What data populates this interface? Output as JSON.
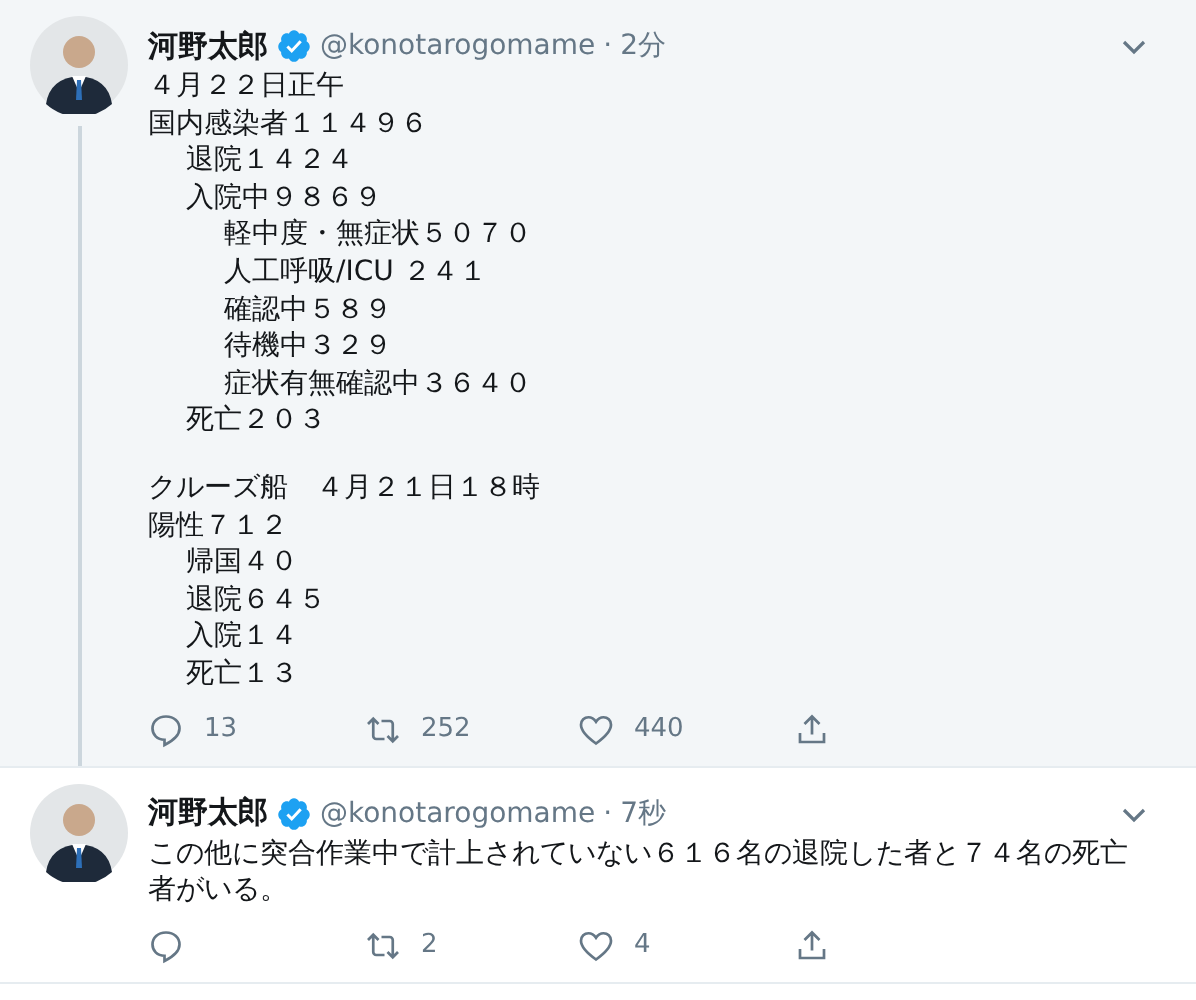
{
  "tweets": [
    {
      "author": {
        "name": "河野太郎",
        "verified": true,
        "handle": "@konotarogomame"
      },
      "separator": "·",
      "time": "2分",
      "highlighted": true,
      "thread_line": true,
      "blocks": [
        [
          {
            "text": "４月２２日正午"
          },
          {
            "text": "国内感染者１１４９６",
            "children": [
              {
                "text": "退院１４２４"
              },
              {
                "text": "入院中９８６９",
                "children": [
                  {
                    "text": "軽中度・無症状５０７０"
                  },
                  {
                    "text": "人工呼吸/ICU ２４１"
                  },
                  {
                    "text": "確認中５８９"
                  },
                  {
                    "text": "待機中３２９"
                  },
                  {
                    "text": "症状有無確認中３６４０"
                  }
                ]
              },
              {
                "text": "死亡２０３"
              }
            ]
          }
        ],
        [
          {
            "text": "クルーズ船　４月２１日１８時"
          },
          {
            "text": "陽性７１２",
            "children": [
              {
                "text": "帰国４０"
              },
              {
                "text": "退院６４５"
              },
              {
                "text": "入院１４"
              },
              {
                "text": "死亡１３"
              }
            ]
          }
        ]
      ],
      "actions": [
        {
          "kind": "reply",
          "count": "13"
        },
        {
          "kind": "retweet",
          "count": "252"
        },
        {
          "kind": "like",
          "count": "440"
        },
        {
          "kind": "share"
        }
      ]
    },
    {
      "author": {
        "name": "河野太郎",
        "verified": true,
        "handle": "@konotarogomame"
      },
      "separator": "·",
      "time": "7秒",
      "highlighted": false,
      "thread_line": false,
      "blocks": [
        [
          {
            "text": "この他に突合作業中で計上されていない６１６名の退院した者と７４名の死亡者がいる。"
          }
        ]
      ],
      "actions": [
        {
          "kind": "reply"
        },
        {
          "kind": "retweet",
          "count": "2"
        },
        {
          "kind": "like",
          "count": "4"
        },
        {
          "kind": "share"
        }
      ]
    }
  ]
}
